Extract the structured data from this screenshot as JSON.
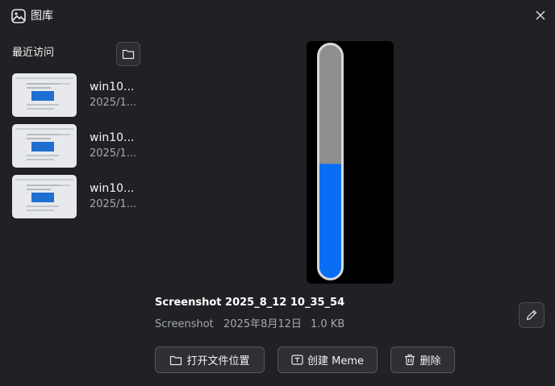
{
  "window": {
    "title": "图库",
    "close_icon": "close-icon"
  },
  "sidebar": {
    "title": "最近访问",
    "items": [
      {
        "name": "win10...",
        "date": "2025/1..."
      },
      {
        "name": "win10...",
        "date": "2025/1..."
      },
      {
        "name": "win10...",
        "date": "2025/1..."
      }
    ]
  },
  "preview": {
    "level": 0.49,
    "colors": {
      "background": "#000000",
      "track": "#8f8f8f",
      "fill": "#0a6ef5",
      "outline": "#d9d9d9"
    }
  },
  "details": {
    "filename": "Screenshot 2025_8_12 10_35_54",
    "folder": "Screenshot",
    "date": "2025年8月12日",
    "size": "1.0 KB"
  },
  "actions": {
    "open_location": "打开文件位置",
    "create_meme": "创建 Meme",
    "delete": "删除"
  }
}
